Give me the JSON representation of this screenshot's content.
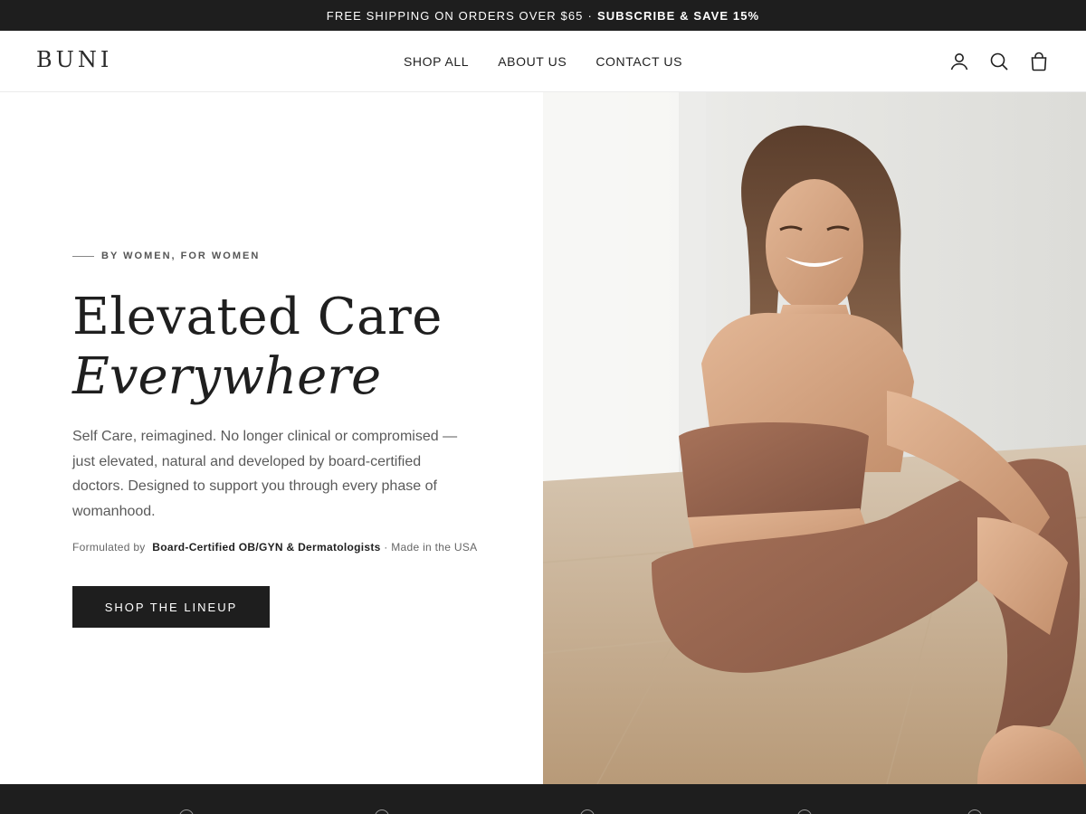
{
  "announcement": {
    "shipping": "FREE SHIPPING ON ORDERS OVER $65",
    "separator": "·",
    "subscribe": "SUBSCRIBE & SAVE 15%"
  },
  "header": {
    "logo": "BUNI",
    "nav": [
      "SHOP ALL",
      "ABOUT US",
      "CONTACT US"
    ],
    "icons": [
      "account-icon",
      "search-icon",
      "cart-icon"
    ]
  },
  "hero": {
    "eyebrow": "BY WOMEN, FOR WOMEN",
    "headline_line1": "Elevated Care",
    "headline_line2": "Everywhere",
    "body": "Self Care, reimagined. No longer clinical or compromised —just elevated, natural and developed by board-certified doctors. Designed to support you through every phase of womanhood.",
    "formulated_prefix": "Formulated by",
    "formulated_bold": "Board-Certified OB/GYN & Dermatologists",
    "formulated_suffix": "· Made in the USA",
    "cta": "SHOP THE LINEUP"
  },
  "colors": {
    "dark": "#1e1e1e",
    "body_text": "#5a5a5a",
    "background": "#ffffff"
  }
}
